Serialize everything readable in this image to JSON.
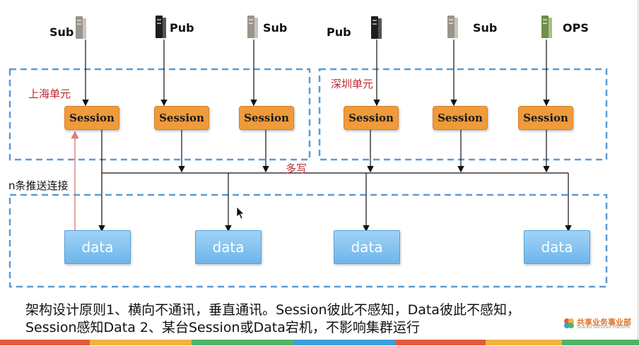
{
  "top_nodes": [
    {
      "label": "Sub",
      "icon": "server-icon",
      "color": "#9a958c"
    },
    {
      "label": "Pub",
      "icon": "server-icon",
      "color": "#1e1e1e"
    },
    {
      "label": "Sub",
      "icon": "server-icon",
      "color": "#9a958c"
    },
    {
      "label": "Pub",
      "icon": "server-icon",
      "color": "#1e1e1e"
    },
    {
      "label": "Sub",
      "icon": "server-icon",
      "color": "#9a958c"
    },
    {
      "label": "OPS",
      "icon": "server-icon",
      "color": "#6f8f4a"
    }
  ],
  "units": {
    "shanghai": "上海单元",
    "shenzhen": "深圳单元"
  },
  "sessions": [
    "Session",
    "Session",
    "Session",
    "Session",
    "Session",
    "Session"
  ],
  "labels": {
    "multi_write": "多写",
    "n_push": "n条推送连接"
  },
  "data_nodes": [
    "data",
    "data",
    "data",
    "data"
  ],
  "caption": {
    "line1": "架构设计原则1、横向不通讯，垂直通讯。Session彼此不感知，Data彼此不感知，",
    "line2": "Session感知Data 2、某台Session或Data宕机，不影响集群运行"
  },
  "logo": {
    "cn": "共享业务事业部",
    "en": "Shared Services Platform"
  },
  "colors": {
    "session": "#ef9a3b",
    "data": "#7dbff0",
    "dashed_border": "#5b9bd5",
    "unit_label": "#c0262d",
    "push_line": "#e8a0a0"
  },
  "footer_bar_colors": [
    "#e25b3c",
    "#f0b43c",
    "#4fb36b",
    "#3aa0d8",
    "#e25b3c",
    "#f0b43c",
    "#4fb36b"
  ]
}
